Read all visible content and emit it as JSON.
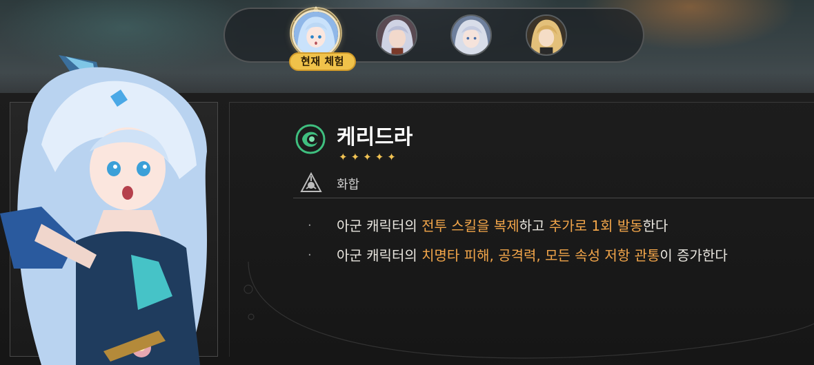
{
  "switcher": {
    "current_badge": "현재 체험",
    "avatars": [
      {
        "icon": "avatar-blue-hair-girl",
        "active": true
      },
      {
        "icon": "avatar-silver-hair-boy",
        "active": false
      },
      {
        "icon": "avatar-silver-hair-girl",
        "active": false
      },
      {
        "icon": "avatar-blonde-boy",
        "active": false
      }
    ]
  },
  "character": {
    "name": "케리드라",
    "stars": "✦✦✦✦✦",
    "rarity": 5,
    "element_icon": "wind-element-icon",
    "path_icon": "harmony-path-icon",
    "path": "화합"
  },
  "description": {
    "line1": {
      "p1": "아군 캐릭터의 ",
      "h1": "전투 스킬을 복제",
      "p2": "하고 ",
      "h2": "추가로 1회 발동",
      "p3": "한다"
    },
    "line2": {
      "p1": "아군 캐릭터의 ",
      "h1": "치명타 피해, 공격력, 모든 속성 저항 관통",
      "p2": "이 증가한다"
    }
  },
  "colors": {
    "highlight": "#f3a64a",
    "star": "#f2c353",
    "badge": "#f0c24a",
    "wind": "#3fbf7f"
  }
}
